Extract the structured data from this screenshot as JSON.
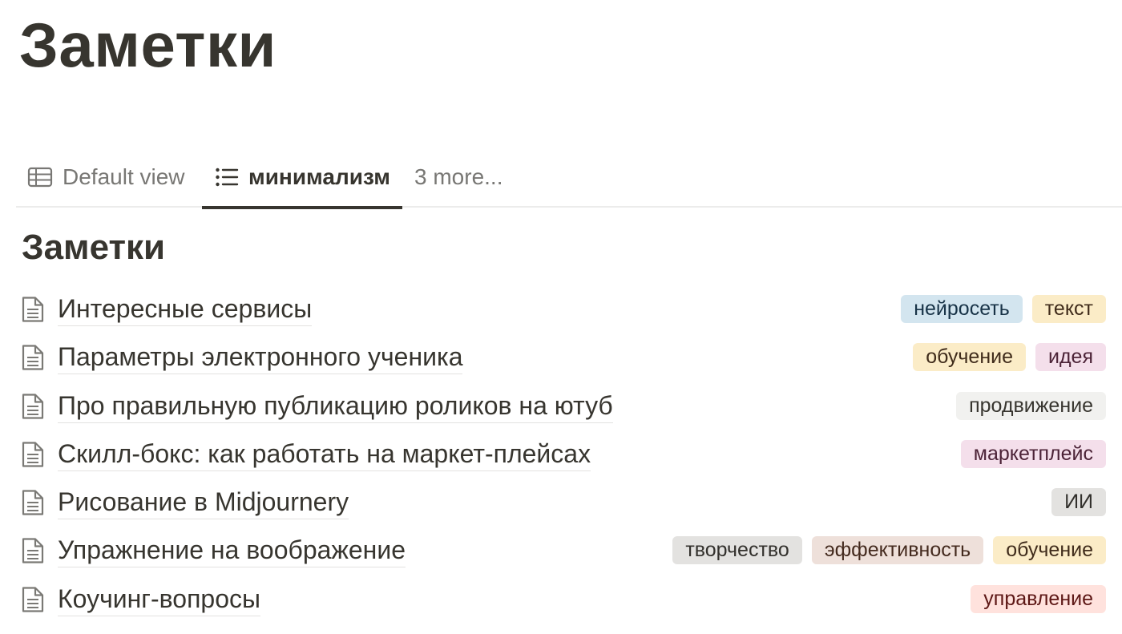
{
  "page": {
    "title": "Заметки"
  },
  "tabs": [
    {
      "label": "Default view",
      "icon": "table-icon",
      "active": false
    },
    {
      "label": "минимализм",
      "icon": "list-icon",
      "active": true
    },
    {
      "label": "3 more...",
      "icon": "",
      "active": false
    }
  ],
  "section": {
    "title": "Заметки"
  },
  "notes": [
    {
      "title": "Интересные сервисы",
      "icon": "document-icon",
      "tags": [
        {
          "label": "нейросеть",
          "bg": "#d3e5ef",
          "fg": "#183347"
        },
        {
          "label": "текст",
          "bg": "#fbecc7",
          "fg": "#402c1b"
        }
      ]
    },
    {
      "title": "Параметры электронного ученика",
      "icon": "document-icon",
      "tags": [
        {
          "label": "обучение",
          "bg": "#fbecc7",
          "fg": "#402c1b"
        },
        {
          "label": "идея",
          "bg": "#f4dfeb",
          "fg": "#4c2337"
        }
      ]
    },
    {
      "title": "Про правильную публикацию роликов на ютуб",
      "icon": "document-icon",
      "tags": [
        {
          "label": "продвижение",
          "bg": "#f1f1ef",
          "fg": "#37352f"
        }
      ]
    },
    {
      "title": "Скилл-бокс: как работать на маркет-плейсах",
      "icon": "document-icon",
      "tags": [
        {
          "label": "маркетплейс",
          "bg": "#f4dfeb",
          "fg": "#4c2337"
        }
      ]
    },
    {
      "title": "Рисование в Midjournery",
      "icon": "document-icon",
      "tags": [
        {
          "label": "ИИ",
          "bg": "#e3e2e0",
          "fg": "#32302c"
        }
      ]
    },
    {
      "title": "Упражнение на воображение",
      "icon": "document-icon",
      "tags": [
        {
          "label": "творчество",
          "bg": "#e3e2e0",
          "fg": "#32302c"
        },
        {
          "label": "эффективность",
          "bg": "#eee0da",
          "fg": "#442a1e"
        },
        {
          "label": "обучение",
          "bg": "#fbecc7",
          "fg": "#402c1b"
        }
      ]
    },
    {
      "title": "Коучинг-вопросы",
      "icon": "document-icon",
      "tags": [
        {
          "label": "управление",
          "bg": "#ffe2dd",
          "fg": "#5d1715"
        }
      ]
    }
  ]
}
